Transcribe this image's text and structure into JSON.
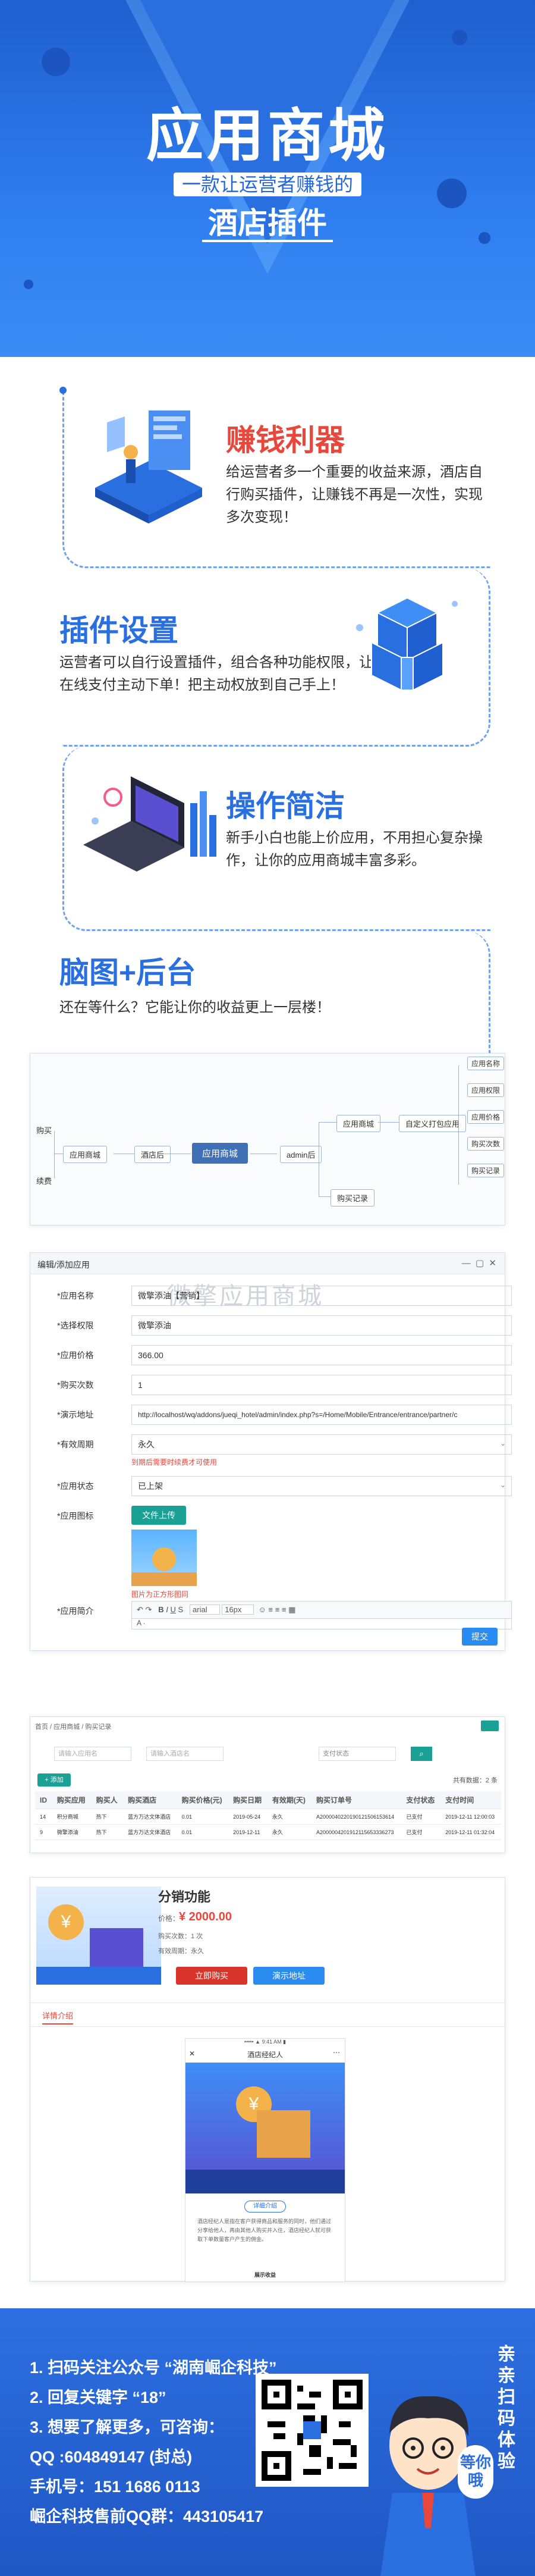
{
  "hero": {
    "title": "应用商城",
    "subtitle": "一款让运营者赚钱的",
    "tagline": "酒店插件"
  },
  "features": [
    {
      "title": "赚钱利器",
      "text": "给运营者多一个重要的收益来源，酒店自行购买插件，让赚钱不再是一次性，实现多次变现！",
      "color": "#e8473c"
    },
    {
      "title": "插件设置",
      "text": "运营者可以自行设置插件，组合各种功能权限，让酒店在线支付主动下单！把主动权放到自己手上！",
      "color": "#2a6fe0"
    },
    {
      "title": "操作简洁",
      "text": "新手小白也能上价应用，不用担心复杂操作，让你的应用商城丰富多彩。",
      "color": "#2a6fe0"
    },
    {
      "title": "脑图+后台",
      "text": "还在等什么？它能让你的收益更上一层楼！",
      "color": "#2a6fe0"
    }
  ],
  "mindmap": {
    "center": "应用商城",
    "hotel": "酒店后",
    "admin": "admin后",
    "left_top": "购买",
    "left_bottom": "续费",
    "left_mid": "应用商城",
    "branch_a": "应用商城",
    "branch_b": "购买记录",
    "mid_a": "自定义打包应用",
    "right": [
      "应用名称",
      "应用权限",
      "应用价格",
      "购买次数",
      "购买记录",
      "购买次数"
    ]
  },
  "form": {
    "header": "编辑/添加应用",
    "watermark": "微擎应用商城",
    "rows": [
      {
        "label": "*应用名称",
        "value": "微擎添油【营销】"
      },
      {
        "label": "*选择权限",
        "value": "微擎添油"
      },
      {
        "label": "*应用价格",
        "value": "366.00"
      },
      {
        "label": "*购买次数",
        "value": "1"
      },
      {
        "label": "*演示地址",
        "value": "http://localhost/wq/addons/jueqi_hotel/admin/index.php?s=/Home/Mobile/Entrance/entrance/partner/c"
      },
      {
        "label": "*有效周期",
        "value": "永久"
      },
      {
        "label": "*应用状态",
        "value": "已上架"
      },
      {
        "label": "*应用图标",
        "value": ""
      },
      {
        "label": "*应用简介",
        "value": ""
      }
    ],
    "period_hint": "到期后需要时续费才可使用",
    "upload_label": "文件上传",
    "icon_hint": "图片为正方形图同",
    "font_select": "arial",
    "size_select": "16px",
    "submit_label": "提交"
  },
  "list": {
    "breadcrumb": "首页 / 应用商城 / 购买记录",
    "filters": [
      "请输入应用名",
      "请输入酒店名",
      "支付状态"
    ],
    "add_label": "+ 添加",
    "total": "共有数据：2 条",
    "headers": [
      "ID",
      "购买应用",
      "购买人",
      "购买酒店",
      "购买价格(元)",
      "购买日期",
      "有效期(天)",
      "购买订单号",
      "支付状态",
      "支付时间"
    ],
    "rows": [
      [
        "14",
        "积分商城",
        "热下",
        "蓝方万达文体酒店",
        "0.01",
        "2019-05-24",
        "永久",
        "A2000040220190121506153614",
        "已支付",
        "2019-12-11 12:00:03"
      ],
      [
        "9",
        "微擎添油",
        "热下",
        "蓝方万达文体酒店",
        "0.01",
        "2019-12-11",
        "永久",
        "A2000004201912115653336273",
        "已支付",
        "2019-12-11 01:32:04"
      ]
    ]
  },
  "product": {
    "name": "分销功能",
    "price_label": "价格：",
    "price": "¥ 2000.00",
    "count_label": "购买次数：1 次",
    "period_label": "有效周期：永久",
    "buy_label": "立即购买",
    "demo_label": "演示地址",
    "tab": "详情介绍",
    "phone_title": "酒店经纪人",
    "phone_section": "详细介绍",
    "phone_text": "酒店经纪人是指在客户获得商品和服务的同时，他们通过分享给他人，再由其他人购买并入住，酒店经纪人就可获取下单数量客户产生的佣金。",
    "phone_footer": "展示收益"
  },
  "footer": {
    "lines": [
      "1. 扫码关注公众号 “湖南崛企科技”",
      "2. 回复关键字 “18”",
      "3. 想要了解更多，可咨询：",
      "QQ :604849147 (封总)",
      "手机号：151 1686 0113",
      "崛企科技售前QQ群：443105417"
    ],
    "vertical": "亲亲扫码体验",
    "bubble": "等你哦"
  },
  "colors": {
    "brand": "#2a6fe0",
    "red": "#e8473c",
    "green": "#1aa094",
    "orange": "#f39c12"
  }
}
